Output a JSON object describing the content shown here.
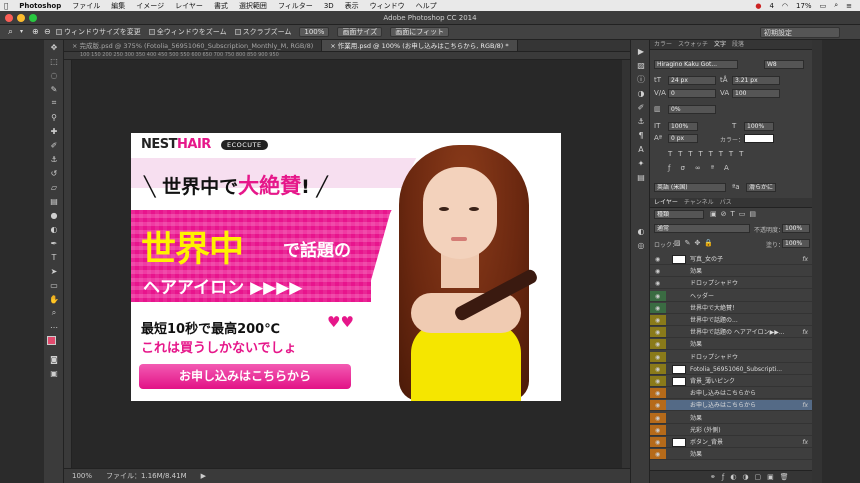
{
  "menubar": {
    "app": "Photoshop",
    "items": [
      "ファイル",
      "編集",
      "イメージ",
      "レイヤー",
      "書式",
      "選択範囲",
      "フィルター",
      "3D",
      "表示",
      "ウィンドウ",
      "ヘルプ"
    ],
    "status": [
      "4",
      "17%"
    ]
  },
  "titlebar": {
    "title": "Adobe Photoshop CC 2014"
  },
  "options": {
    "check1": "ウィンドウサイズを変更",
    "check2": "全ウィンドウをズーム",
    "check3": "スクラブズーム",
    "zoom_value": "100%",
    "btn_fit_screen": "画面サイズ",
    "btn_fill_screen": "画面にフィット",
    "workspace": "初期設定"
  },
  "tabs": [
    {
      "label": "完成版.psd @ 375% (Fotolia_56951060_Subscription_Monthly_M, RGB/8)"
    },
    {
      "label": "作業用.psd @ 100% (お申し込みはこちらから, RGB/8) *"
    }
  ],
  "ruler_ticks": "100    150    200    250    300    350    400    450    500    550    600    650    700    750    800    850    900    950",
  "statusbar": {
    "zoom": "100%",
    "file": "ファイル：1.16M/8.41M"
  },
  "banner": {
    "logo_main": "NEST",
    "logo_hair": "HAIR",
    "eco_badge": "ECOCUTE",
    "headline_pre": "世界中で",
    "headline_hl": "大絶賛",
    "headline_post": "!",
    "big_text": "世界中",
    "big_text2": "で話題の",
    "line2": "ヘアアイロン ▶▶▶▶",
    "small1": "最短10秒で最高200℃",
    "small2": "これは買うしかないでしょ",
    "cta": "お申し込みはこちらから"
  },
  "char_panel": {
    "tabs": [
      "カラー",
      "スウォッチ",
      "文字",
      "段落"
    ],
    "font": "Hiragino Kaku Got...",
    "weight": "W8",
    "size": "24 px",
    "leading": "3.21 px",
    "kerning": "0",
    "tracking": "100",
    "tsume": "0%",
    "vscale": "100%",
    "hscale": "100%",
    "baseline": "0 px",
    "color_label": "カラー：",
    "lang": "英語 (米国)",
    "aa": "滑らかに"
  },
  "layers_panel": {
    "tabs": [
      "レイヤー",
      "チャンネル",
      "パス"
    ],
    "filter": "種類",
    "blend": "通常",
    "opacity_label": "不透明度：",
    "opacity": "100%",
    "lock_label": "ロック：",
    "fill_label": "塗り：",
    "fill": "100%",
    "layers": [
      {
        "name": "写真_女の子",
        "fx": "fx",
        "band": "#3e3e3e",
        "thumb": true
      },
      {
        "name": "効果",
        "band": "#3e3e3e"
      },
      {
        "name": "ドロップシャドウ",
        "band": "#3e3e3e"
      },
      {
        "name": "ヘッダー",
        "band": "#3a6b42"
      },
      {
        "name": "世界中で大絶賛！",
        "band": "#3a6b42"
      },
      {
        "name": "世界中で話題の...",
        "band": "#8a7a1a"
      },
      {
        "name": "世界中で話題の ヘアアイロン▶▶...",
        "fx": "fx",
        "band": "#8a7a1a"
      },
      {
        "name": "効果",
        "band": "#8a7a1a"
      },
      {
        "name": "ドロップシャドウ",
        "band": "#8a7a1a"
      },
      {
        "name": "Fotolia_56951060_Subscripti...",
        "band": "#8a7a1a",
        "thumb": true
      },
      {
        "name": "背景_薄いピンク",
        "band": "#8a7a1a",
        "thumb": true
      },
      {
        "name": "お申し込みはこちらから",
        "band": "#b56a1a"
      },
      {
        "name": "お申し込みはこちらから",
        "fx": "fx",
        "band": "#b56a1a",
        "sel": true
      },
      {
        "name": "効果",
        "band": "#b56a1a"
      },
      {
        "name": "光彩 (外側)",
        "band": "#b56a1a"
      },
      {
        "name": "ボタン_背景",
        "fx": "fx",
        "band": "#b56a1a",
        "thumb": true
      },
      {
        "name": "効果",
        "band": "#b56a1a"
      }
    ]
  }
}
